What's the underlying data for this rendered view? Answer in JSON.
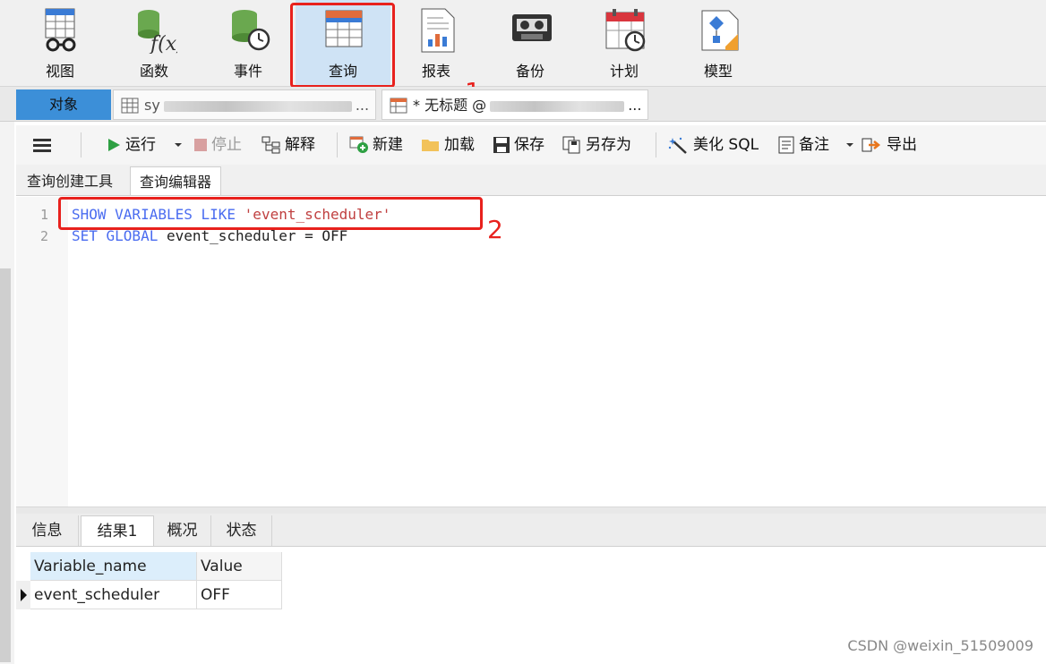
{
  "ribbon": {
    "buttons": [
      {
        "label": "视图",
        "icon": "view-icon"
      },
      {
        "label": "函数",
        "icon": "function-icon"
      },
      {
        "label": "事件",
        "icon": "event-icon"
      },
      {
        "label": "查询",
        "icon": "query-icon",
        "active": true
      },
      {
        "label": "报表",
        "icon": "report-icon"
      },
      {
        "label": "备份",
        "icon": "backup-icon"
      },
      {
        "label": "计划",
        "icon": "schedule-icon"
      },
      {
        "label": "模型",
        "icon": "model-icon"
      }
    ]
  },
  "annotations": {
    "marker1": "1",
    "marker2": "2",
    "color": "#e8211d"
  },
  "tabs": {
    "objects": "对象",
    "table_tab": "sy",
    "table_tab_suffix": "...",
    "query_tab": "* 无标题 @",
    "query_tab_suffix": "..."
  },
  "toolbar": {
    "run": "运行",
    "stop": "停止",
    "explain": "解释",
    "new": "新建",
    "load": "加载",
    "save": "保存",
    "save_as": "另存为",
    "beautify": "美化 SQL",
    "comment": "备注",
    "export": "导出"
  },
  "subtabs": {
    "builder": "查询创建工具",
    "editor": "查询编辑器"
  },
  "editor": {
    "lines": [
      {
        "number": "1",
        "kw": "SHOW VARIABLES LIKE",
        "str": "'event_scheduler'"
      },
      {
        "number": "2",
        "kw": "SET GLOBAL",
        "rest": "event_scheduler = OFF"
      }
    ]
  },
  "results": {
    "tabs": [
      "信息",
      "结果1",
      "概况",
      "状态"
    ],
    "active_tab": "结果1",
    "columns": [
      "Variable_name",
      "Value"
    ],
    "rows": [
      [
        "event_scheduler",
        "OFF"
      ]
    ]
  },
  "watermark": "CSDN @weixin_51509009",
  "colors": {
    "accent": "#3c8fd8",
    "active_button": "#cfe3f5",
    "keyword": "#4a6cf0",
    "string": "#c04040"
  }
}
